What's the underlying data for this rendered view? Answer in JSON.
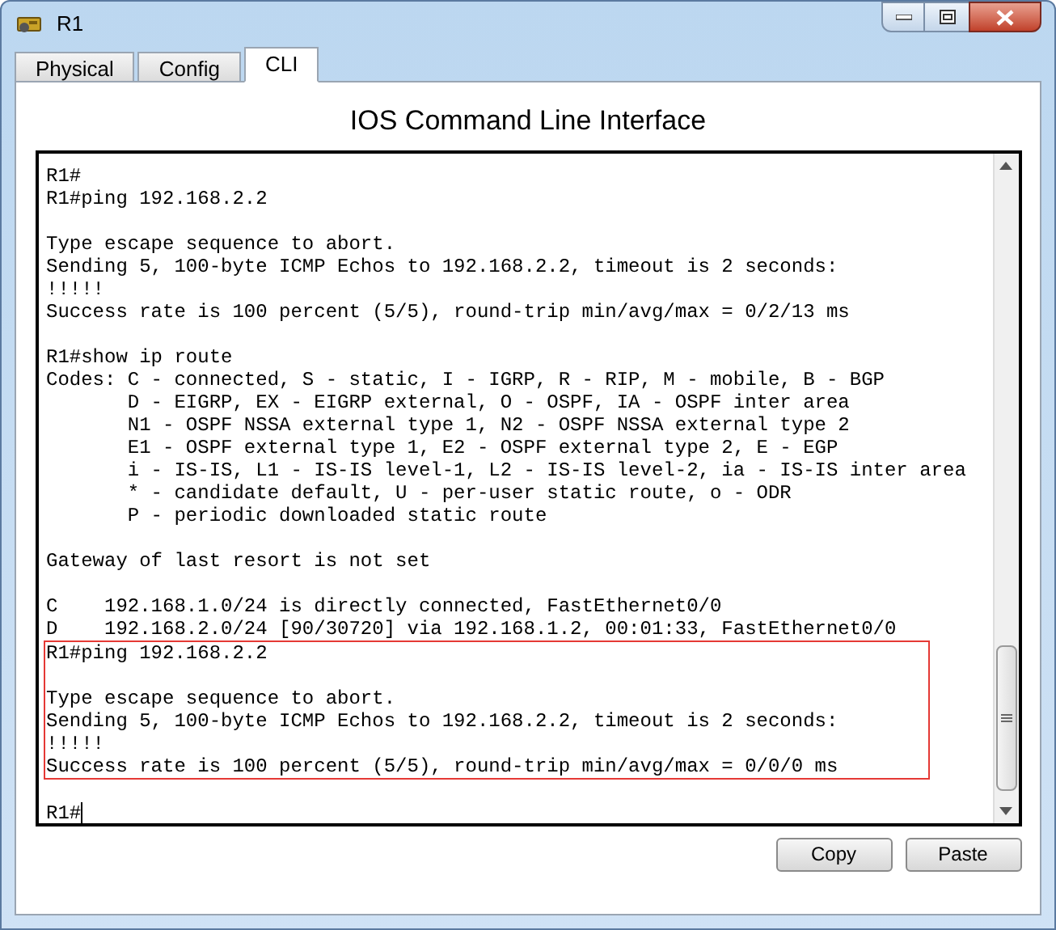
{
  "window": {
    "title": "R1"
  },
  "tabs": [
    {
      "label": "Physical",
      "selected": false
    },
    {
      "label": "Config",
      "selected": false
    },
    {
      "label": "CLI",
      "selected": true
    }
  ],
  "panel_title": "IOS Command Line Interface",
  "terminal": {
    "cursor_visible": true,
    "lines": [
      {
        "kind": "text",
        "text": "R1#",
        "highlighted": false
      },
      {
        "kind": "text",
        "text": "R1#ping 192.168.2.2",
        "highlighted": false
      },
      {
        "kind": "blank",
        "highlighted": false
      },
      {
        "kind": "text",
        "text": "Type escape sequence to abort.",
        "highlighted": false
      },
      {
        "kind": "text",
        "text": "Sending 5, 100-byte ICMP Echos to 192.168.2.2, timeout is 2 seconds:",
        "highlighted": false
      },
      {
        "kind": "text",
        "text": "!!!!!",
        "highlighted": false
      },
      {
        "kind": "text",
        "text": "Success rate is 100 percent (5/5), round-trip min/avg/max = 0/2/13 ms",
        "highlighted": false
      },
      {
        "kind": "blank",
        "highlighted": false
      },
      {
        "kind": "text",
        "text": "R1#show ip route",
        "highlighted": false
      },
      {
        "kind": "text",
        "text": "Codes: C - connected, S - static, I - IGRP, R - RIP, M - mobile, B - BGP",
        "highlighted": false
      },
      {
        "kind": "text",
        "text": "       D - EIGRP, EX - EIGRP external, O - OSPF, IA - OSPF inter area",
        "highlighted": false
      },
      {
        "kind": "text",
        "text": "       N1 - OSPF NSSA external type 1, N2 - OSPF NSSA external type 2",
        "highlighted": false
      },
      {
        "kind": "text",
        "text": "       E1 - OSPF external type 1, E2 - OSPF external type 2, E - EGP",
        "highlighted": false
      },
      {
        "kind": "text",
        "text": "       i - IS-IS, L1 - IS-IS level-1, L2 - IS-IS level-2, ia - IS-IS inter area",
        "highlighted": false
      },
      {
        "kind": "text",
        "text": "       * - candidate default, U - per-user static route, o - ODR",
        "highlighted": false
      },
      {
        "kind": "text",
        "text": "       P - periodic downloaded static route",
        "highlighted": false
      },
      {
        "kind": "blank",
        "highlighted": false
      },
      {
        "kind": "text",
        "text": "Gateway of last resort is not set",
        "highlighted": false
      },
      {
        "kind": "blank",
        "highlighted": false
      },
      {
        "kind": "text",
        "text": "C    192.168.1.0/24 is directly connected, FastEthernet0/0",
        "highlighted": false
      },
      {
        "kind": "text",
        "text": "D    192.168.2.0/24 [90/30720] via 192.168.1.2, 00:01:33, FastEthernet0/0",
        "highlighted": false
      },
      {
        "kind": "text",
        "text": "R1#ping 192.168.2.2",
        "highlighted": true
      },
      {
        "kind": "blank",
        "highlighted": true
      },
      {
        "kind": "text",
        "text": "Type escape sequence to abort.",
        "highlighted": true
      },
      {
        "kind": "text",
        "text": "Sending 5, 100-byte ICMP Echos to 192.168.2.2, timeout is 2 seconds:",
        "highlighted": true
      },
      {
        "kind": "text",
        "text": "!!!!!",
        "highlighted": true
      },
      {
        "kind": "text",
        "text": "Success rate is 100 percent (5/5), round-trip min/avg/max = 0/0/0 ms",
        "highlighted": true
      },
      {
        "kind": "blank",
        "highlighted": false
      },
      {
        "kind": "text",
        "text": "R1#",
        "highlighted": false
      }
    ]
  },
  "buttons": [
    {
      "label": "Copy"
    },
    {
      "label": "Paste"
    }
  ]
}
